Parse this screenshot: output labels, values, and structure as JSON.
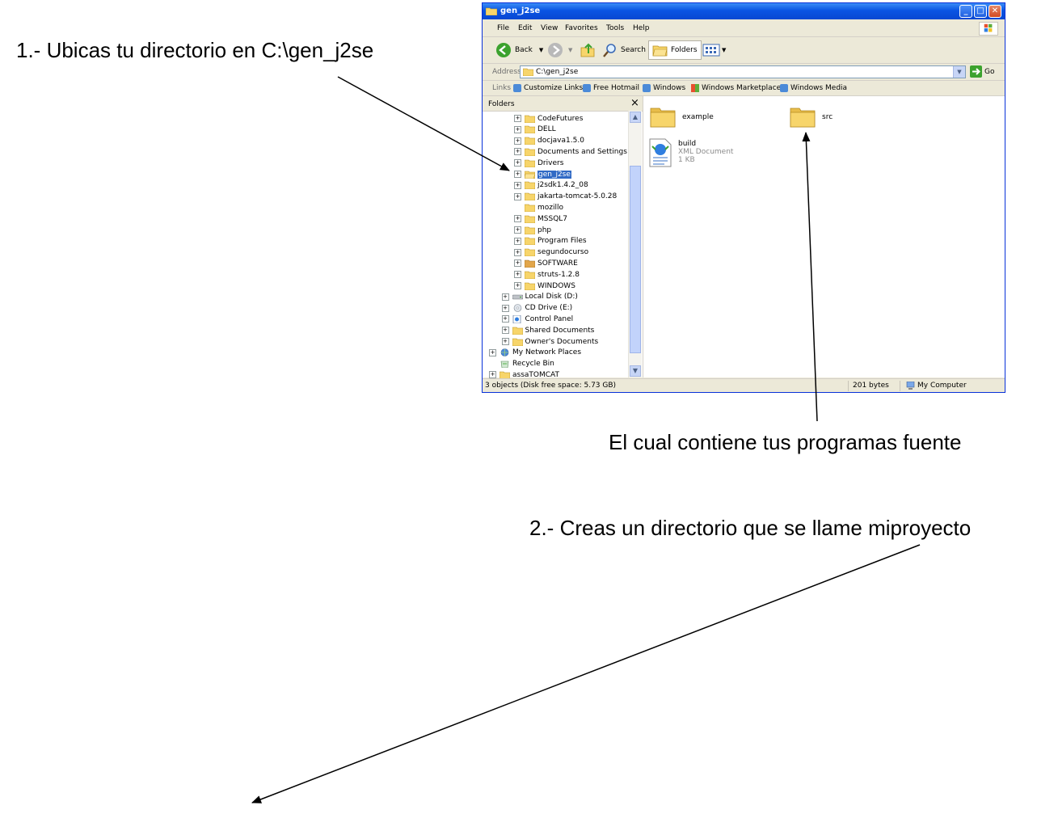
{
  "annotations": {
    "step1": "1.-  Ubicas tu directorio en C:\\gen_j2se",
    "contains": "El cual contiene tus programas fuente",
    "step2": "2.- Creas un directorio que se llame miproyecto"
  },
  "window": {
    "title": "gen_j2se",
    "menu": [
      "File",
      "Edit",
      "View",
      "Favorites",
      "Tools",
      "Help"
    ],
    "toolbar": {
      "back": "Back",
      "search": "Search",
      "folders": "Folders"
    },
    "address": {
      "label": "Address",
      "value": "C:\\gen_j2se",
      "go": "Go"
    },
    "links": {
      "label": "Links",
      "items": [
        "Customize Links",
        "Free Hotmail",
        "Windows",
        "Windows Marketplace",
        "Windows Media"
      ]
    },
    "folders_pane": {
      "title": "Folders",
      "close": "×",
      "tree": [
        {
          "label": "CodeFutures",
          "level": 2,
          "exp": "+",
          "icon": "folder"
        },
        {
          "label": "DELL",
          "level": 2,
          "exp": "+",
          "icon": "folder"
        },
        {
          "label": "docjava1.5.0",
          "level": 2,
          "exp": "+",
          "icon": "folder"
        },
        {
          "label": "Documents and Settings",
          "level": 2,
          "exp": "+",
          "icon": "folder"
        },
        {
          "label": "Drivers",
          "level": 2,
          "exp": "+",
          "icon": "folder"
        },
        {
          "label": "gen_j2se",
          "level": 2,
          "exp": "+",
          "icon": "folder-open",
          "selected": true
        },
        {
          "label": "j2sdk1.4.2_08",
          "level": 2,
          "exp": "+",
          "icon": "folder"
        },
        {
          "label": "jakarta-tomcat-5.0.28",
          "level": 2,
          "exp": "+",
          "icon": "folder"
        },
        {
          "label": "mozillo",
          "level": 2,
          "exp": "",
          "icon": "folder"
        },
        {
          "label": "MSSQL7",
          "level": 2,
          "exp": "+",
          "icon": "folder"
        },
        {
          "label": "php",
          "level": 2,
          "exp": "+",
          "icon": "folder"
        },
        {
          "label": "Program Files",
          "level": 2,
          "exp": "+",
          "icon": "folder"
        },
        {
          "label": "segundocurso",
          "level": 2,
          "exp": "+",
          "icon": "folder"
        },
        {
          "label": "SOFTWARE",
          "level": 2,
          "exp": "+",
          "icon": "folder-shared"
        },
        {
          "label": "struts-1.2.8",
          "level": 2,
          "exp": "+",
          "icon": "folder"
        },
        {
          "label": "WINDOWS",
          "level": 2,
          "exp": "+",
          "icon": "folder"
        },
        {
          "label": "Local Disk (D:)",
          "level": 1,
          "exp": "+",
          "icon": "disk"
        },
        {
          "label": "CD Drive (E:)",
          "level": 1,
          "exp": "+",
          "icon": "cd"
        },
        {
          "label": "Control Panel",
          "level": 1,
          "exp": "+",
          "icon": "control-panel"
        },
        {
          "label": "Shared Documents",
          "level": 1,
          "exp": "+",
          "icon": "folder"
        },
        {
          "label": "Owner's Documents",
          "level": 1,
          "exp": "+",
          "icon": "folder"
        },
        {
          "label": "My Network Places",
          "level": 0,
          "exp": "+",
          "icon": "network"
        },
        {
          "label": "Recycle Bin",
          "level": 0,
          "exp": "",
          "icon": "recycle"
        },
        {
          "label": "assaTOMCAT",
          "level": 0,
          "exp": "+",
          "icon": "folder"
        }
      ]
    },
    "files": [
      {
        "name": "example",
        "type": "folder"
      },
      {
        "name": "src",
        "type": "folder"
      },
      {
        "name": "build",
        "type": "xml",
        "detail": "XML Document",
        "size": "1 KB"
      }
    ],
    "status": {
      "objects": "3 objects (Disk free space: 5.73 GB)",
      "bytes": "201 bytes",
      "location": "My Computer"
    },
    "colors": {
      "title_blue": "#0a54e3",
      "folder_yellow": "#f7d56b",
      "selection": "#316ac5"
    }
  }
}
